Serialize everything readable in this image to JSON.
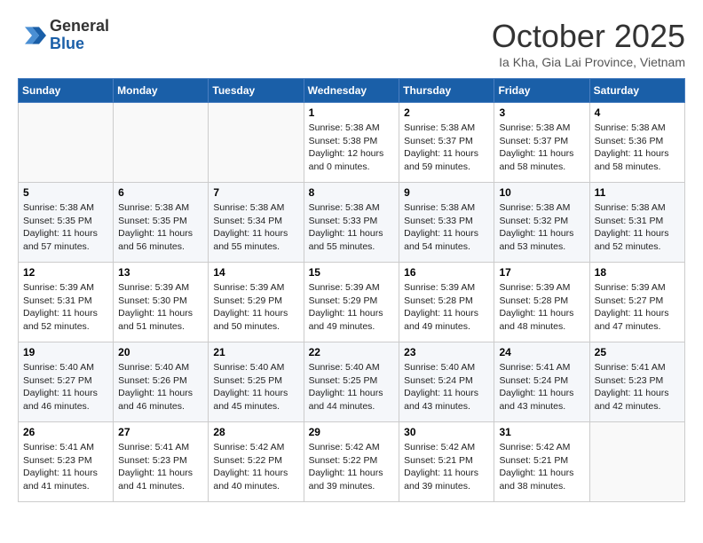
{
  "header": {
    "logo_general": "General",
    "logo_blue": "Blue",
    "month": "October 2025",
    "location": "Ia Kha, Gia Lai Province, Vietnam"
  },
  "weekdays": [
    "Sunday",
    "Monday",
    "Tuesday",
    "Wednesday",
    "Thursday",
    "Friday",
    "Saturday"
  ],
  "weeks": [
    [
      {
        "day": "",
        "info": ""
      },
      {
        "day": "",
        "info": ""
      },
      {
        "day": "",
        "info": ""
      },
      {
        "day": "1",
        "info": "Sunrise: 5:38 AM\nSunset: 5:38 PM\nDaylight: 12 hours\nand 0 minutes."
      },
      {
        "day": "2",
        "info": "Sunrise: 5:38 AM\nSunset: 5:37 PM\nDaylight: 11 hours\nand 59 minutes."
      },
      {
        "day": "3",
        "info": "Sunrise: 5:38 AM\nSunset: 5:37 PM\nDaylight: 11 hours\nand 58 minutes."
      },
      {
        "day": "4",
        "info": "Sunrise: 5:38 AM\nSunset: 5:36 PM\nDaylight: 11 hours\nand 58 minutes."
      }
    ],
    [
      {
        "day": "5",
        "info": "Sunrise: 5:38 AM\nSunset: 5:35 PM\nDaylight: 11 hours\nand 57 minutes."
      },
      {
        "day": "6",
        "info": "Sunrise: 5:38 AM\nSunset: 5:35 PM\nDaylight: 11 hours\nand 56 minutes."
      },
      {
        "day": "7",
        "info": "Sunrise: 5:38 AM\nSunset: 5:34 PM\nDaylight: 11 hours\nand 55 minutes."
      },
      {
        "day": "8",
        "info": "Sunrise: 5:38 AM\nSunset: 5:33 PM\nDaylight: 11 hours\nand 55 minutes."
      },
      {
        "day": "9",
        "info": "Sunrise: 5:38 AM\nSunset: 5:33 PM\nDaylight: 11 hours\nand 54 minutes."
      },
      {
        "day": "10",
        "info": "Sunrise: 5:38 AM\nSunset: 5:32 PM\nDaylight: 11 hours\nand 53 minutes."
      },
      {
        "day": "11",
        "info": "Sunrise: 5:38 AM\nSunset: 5:31 PM\nDaylight: 11 hours\nand 52 minutes."
      }
    ],
    [
      {
        "day": "12",
        "info": "Sunrise: 5:39 AM\nSunset: 5:31 PM\nDaylight: 11 hours\nand 52 minutes."
      },
      {
        "day": "13",
        "info": "Sunrise: 5:39 AM\nSunset: 5:30 PM\nDaylight: 11 hours\nand 51 minutes."
      },
      {
        "day": "14",
        "info": "Sunrise: 5:39 AM\nSunset: 5:29 PM\nDaylight: 11 hours\nand 50 minutes."
      },
      {
        "day": "15",
        "info": "Sunrise: 5:39 AM\nSunset: 5:29 PM\nDaylight: 11 hours\nand 49 minutes."
      },
      {
        "day": "16",
        "info": "Sunrise: 5:39 AM\nSunset: 5:28 PM\nDaylight: 11 hours\nand 49 minutes."
      },
      {
        "day": "17",
        "info": "Sunrise: 5:39 AM\nSunset: 5:28 PM\nDaylight: 11 hours\nand 48 minutes."
      },
      {
        "day": "18",
        "info": "Sunrise: 5:39 AM\nSunset: 5:27 PM\nDaylight: 11 hours\nand 47 minutes."
      }
    ],
    [
      {
        "day": "19",
        "info": "Sunrise: 5:40 AM\nSunset: 5:27 PM\nDaylight: 11 hours\nand 46 minutes."
      },
      {
        "day": "20",
        "info": "Sunrise: 5:40 AM\nSunset: 5:26 PM\nDaylight: 11 hours\nand 46 minutes."
      },
      {
        "day": "21",
        "info": "Sunrise: 5:40 AM\nSunset: 5:25 PM\nDaylight: 11 hours\nand 45 minutes."
      },
      {
        "day": "22",
        "info": "Sunrise: 5:40 AM\nSunset: 5:25 PM\nDaylight: 11 hours\nand 44 minutes."
      },
      {
        "day": "23",
        "info": "Sunrise: 5:40 AM\nSunset: 5:24 PM\nDaylight: 11 hours\nand 43 minutes."
      },
      {
        "day": "24",
        "info": "Sunrise: 5:41 AM\nSunset: 5:24 PM\nDaylight: 11 hours\nand 43 minutes."
      },
      {
        "day": "25",
        "info": "Sunrise: 5:41 AM\nSunset: 5:23 PM\nDaylight: 11 hours\nand 42 minutes."
      }
    ],
    [
      {
        "day": "26",
        "info": "Sunrise: 5:41 AM\nSunset: 5:23 PM\nDaylight: 11 hours\nand 41 minutes."
      },
      {
        "day": "27",
        "info": "Sunrise: 5:41 AM\nSunset: 5:23 PM\nDaylight: 11 hours\nand 41 minutes."
      },
      {
        "day": "28",
        "info": "Sunrise: 5:42 AM\nSunset: 5:22 PM\nDaylight: 11 hours\nand 40 minutes."
      },
      {
        "day": "29",
        "info": "Sunrise: 5:42 AM\nSunset: 5:22 PM\nDaylight: 11 hours\nand 39 minutes."
      },
      {
        "day": "30",
        "info": "Sunrise: 5:42 AM\nSunset: 5:21 PM\nDaylight: 11 hours\nand 39 minutes."
      },
      {
        "day": "31",
        "info": "Sunrise: 5:42 AM\nSunset: 5:21 PM\nDaylight: 11 hours\nand 38 minutes."
      },
      {
        "day": "",
        "info": ""
      }
    ]
  ]
}
